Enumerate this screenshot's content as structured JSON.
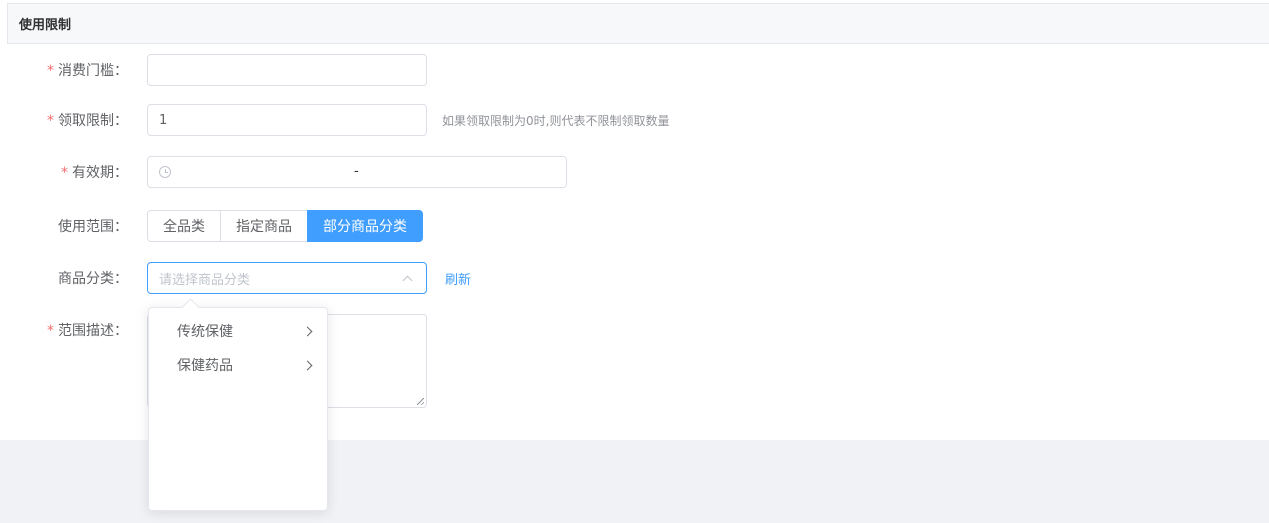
{
  "section": {
    "title": "使用限制"
  },
  "form": {
    "threshold": {
      "label": "消费门槛：",
      "required_mark": "*",
      "value": ""
    },
    "claim_limit": {
      "label": "领取限制：",
      "required_mark": "*",
      "value": "1",
      "hint": "如果领取限制为0时,则代表不限制领取数量"
    },
    "validity": {
      "label": "有效期：",
      "required_mark": "*",
      "separator": "-",
      "icon": "clock-icon"
    },
    "scope": {
      "label": "使用范围：",
      "options": [
        "全品类",
        "指定商品",
        "部分商品分类"
      ],
      "active_index": 2
    },
    "category": {
      "label": "商品分类：",
      "placeholder": "请选择商品分类",
      "refresh_label": "刷新"
    },
    "scope_desc": {
      "label": "范围描述：",
      "required_mark": "*"
    }
  },
  "dropdown": {
    "items": [
      {
        "label": "传统保健"
      },
      {
        "label": "保健药品"
      }
    ]
  },
  "colors": {
    "accent": "#409eff",
    "required": "#f56c6c"
  }
}
